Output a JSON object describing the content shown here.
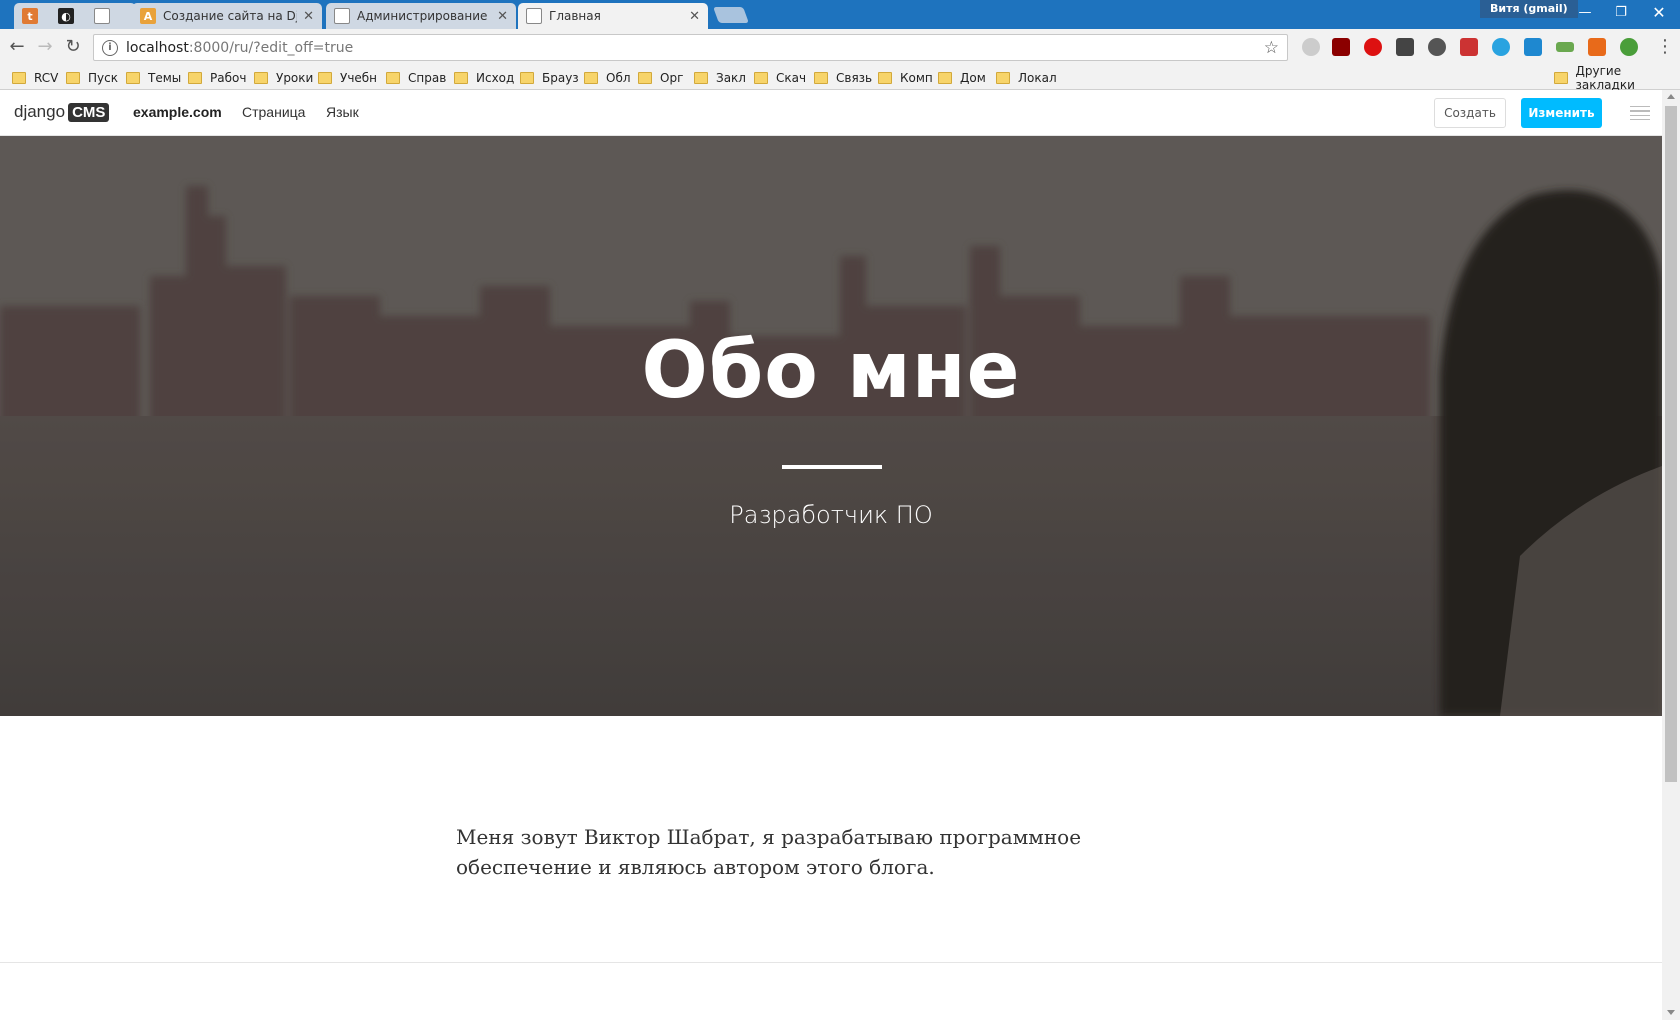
{
  "browser": {
    "tabs": [
      {
        "title": "",
        "favicon": "tumblr-favicon",
        "color": "#e07a33",
        "glyph": "t"
      },
      {
        "title": "",
        "favicon": "github-favicon",
        "color": "#222222",
        "glyph": "◐"
      },
      {
        "title": "",
        "favicon": "document-favicon",
        "color": "#9aa5b1",
        "glyph": ""
      },
      {
        "title": "Создание сайта на Djan",
        "favicon": "amazon-a-favicon",
        "color": "#e9a23b",
        "glyph": "A"
      },
      {
        "title": "Администрирование сай",
        "favicon": "document-favicon",
        "color": "#9aa5b1",
        "glyph": ""
      },
      {
        "title": "Главная",
        "favicon": "document-favicon",
        "color": "#9aa5b1",
        "glyph": ""
      }
    ],
    "profile": "Витя (gmail)",
    "url_host": "localhost",
    "url_rest": ":8000/ru/?edit_off=true",
    "bookmarks": [
      "RCV",
      "Пуск",
      "Темы",
      "Рабоч",
      "Уроки",
      "Учебн",
      "Справ",
      "Исход",
      "Брауз",
      "Обл",
      "Орг",
      "Закл",
      "Скач",
      "Связь",
      "Комп",
      "Дом",
      "Локал"
    ],
    "other_bookmarks": "Другие закладки"
  },
  "cms_toolbar": {
    "logo_text": "django",
    "logo_badge": "CMS",
    "site": "example.com",
    "menu": [
      "Страница",
      "Язык"
    ],
    "create_label": "Создать",
    "edit_label": "Изменить",
    "edit_color": "#00bbff"
  },
  "hero": {
    "title": "Обо мне",
    "subtitle": "Разработчик ПО"
  },
  "content": {
    "paragraph": "Меня зовут Виктор Шабрат, я разрабатываю программное обеспечение и являюсь автором этого блога."
  }
}
